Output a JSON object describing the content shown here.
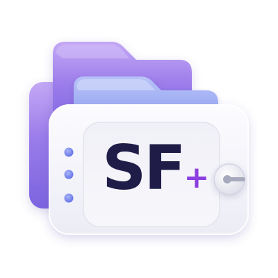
{
  "icon": {
    "name": "folder-app-icon",
    "wordmark_main": "SF",
    "wordmark_suffix": "+",
    "colors": {
      "background": "#ffffff",
      "back_folder": "#8f6fe8",
      "middle_folder": "#7f95ef",
      "front_card": "#f5f5fb",
      "text": "#1f1d48",
      "accent_plus": "#8b3fe0",
      "dots": "#6f7fee",
      "latch": "#9fa3b8"
    }
  }
}
